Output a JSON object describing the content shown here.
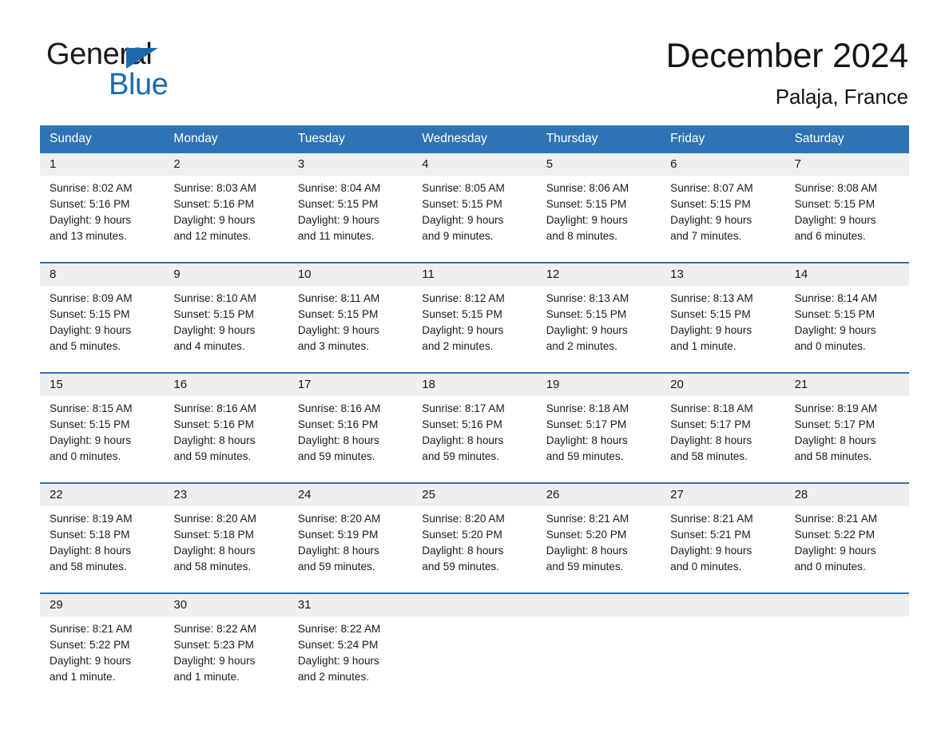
{
  "brand": {
    "name_part1": "General",
    "name_part2": "Blue",
    "triangle_icon": "triangle-icon",
    "accent_color": "#1b6ab0"
  },
  "header": {
    "title": "December 2024",
    "subtitle": "Palaja, France"
  },
  "colors": {
    "header_blue": "#2e74b5",
    "day_band_gray": "#efefef",
    "text": "#1a1a1a"
  },
  "weekdays": [
    "Sunday",
    "Monday",
    "Tuesday",
    "Wednesday",
    "Thursday",
    "Friday",
    "Saturday"
  ],
  "weeks": [
    [
      {
        "day": "1",
        "sunrise": "Sunrise: 8:02 AM",
        "sunset": "Sunset: 5:16 PM",
        "daylight1": "Daylight: 9 hours",
        "daylight2": "and 13 minutes."
      },
      {
        "day": "2",
        "sunrise": "Sunrise: 8:03 AM",
        "sunset": "Sunset: 5:16 PM",
        "daylight1": "Daylight: 9 hours",
        "daylight2": "and 12 minutes."
      },
      {
        "day": "3",
        "sunrise": "Sunrise: 8:04 AM",
        "sunset": "Sunset: 5:15 PM",
        "daylight1": "Daylight: 9 hours",
        "daylight2": "and 11 minutes."
      },
      {
        "day": "4",
        "sunrise": "Sunrise: 8:05 AM",
        "sunset": "Sunset: 5:15 PM",
        "daylight1": "Daylight: 9 hours",
        "daylight2": "and 9 minutes."
      },
      {
        "day": "5",
        "sunrise": "Sunrise: 8:06 AM",
        "sunset": "Sunset: 5:15 PM",
        "daylight1": "Daylight: 9 hours",
        "daylight2": "and 8 minutes."
      },
      {
        "day": "6",
        "sunrise": "Sunrise: 8:07 AM",
        "sunset": "Sunset: 5:15 PM",
        "daylight1": "Daylight: 9 hours",
        "daylight2": "and 7 minutes."
      },
      {
        "day": "7",
        "sunrise": "Sunrise: 8:08 AM",
        "sunset": "Sunset: 5:15 PM",
        "daylight1": "Daylight: 9 hours",
        "daylight2": "and 6 minutes."
      }
    ],
    [
      {
        "day": "8",
        "sunrise": "Sunrise: 8:09 AM",
        "sunset": "Sunset: 5:15 PM",
        "daylight1": "Daylight: 9 hours",
        "daylight2": "and 5 minutes."
      },
      {
        "day": "9",
        "sunrise": "Sunrise: 8:10 AM",
        "sunset": "Sunset: 5:15 PM",
        "daylight1": "Daylight: 9 hours",
        "daylight2": "and 4 minutes."
      },
      {
        "day": "10",
        "sunrise": "Sunrise: 8:11 AM",
        "sunset": "Sunset: 5:15 PM",
        "daylight1": "Daylight: 9 hours",
        "daylight2": "and 3 minutes."
      },
      {
        "day": "11",
        "sunrise": "Sunrise: 8:12 AM",
        "sunset": "Sunset: 5:15 PM",
        "daylight1": "Daylight: 9 hours",
        "daylight2": "and 2 minutes."
      },
      {
        "day": "12",
        "sunrise": "Sunrise: 8:13 AM",
        "sunset": "Sunset: 5:15 PM",
        "daylight1": "Daylight: 9 hours",
        "daylight2": "and 2 minutes."
      },
      {
        "day": "13",
        "sunrise": "Sunrise: 8:13 AM",
        "sunset": "Sunset: 5:15 PM",
        "daylight1": "Daylight: 9 hours",
        "daylight2": "and 1 minute."
      },
      {
        "day": "14",
        "sunrise": "Sunrise: 8:14 AM",
        "sunset": "Sunset: 5:15 PM",
        "daylight1": "Daylight: 9 hours",
        "daylight2": "and 0 minutes."
      }
    ],
    [
      {
        "day": "15",
        "sunrise": "Sunrise: 8:15 AM",
        "sunset": "Sunset: 5:15 PM",
        "daylight1": "Daylight: 9 hours",
        "daylight2": "and 0 minutes."
      },
      {
        "day": "16",
        "sunrise": "Sunrise: 8:16 AM",
        "sunset": "Sunset: 5:16 PM",
        "daylight1": "Daylight: 8 hours",
        "daylight2": "and 59 minutes."
      },
      {
        "day": "17",
        "sunrise": "Sunrise: 8:16 AM",
        "sunset": "Sunset: 5:16 PM",
        "daylight1": "Daylight: 8 hours",
        "daylight2": "and 59 minutes."
      },
      {
        "day": "18",
        "sunrise": "Sunrise: 8:17 AM",
        "sunset": "Sunset: 5:16 PM",
        "daylight1": "Daylight: 8 hours",
        "daylight2": "and 59 minutes."
      },
      {
        "day": "19",
        "sunrise": "Sunrise: 8:18 AM",
        "sunset": "Sunset: 5:17 PM",
        "daylight1": "Daylight: 8 hours",
        "daylight2": "and 59 minutes."
      },
      {
        "day": "20",
        "sunrise": "Sunrise: 8:18 AM",
        "sunset": "Sunset: 5:17 PM",
        "daylight1": "Daylight: 8 hours",
        "daylight2": "and 58 minutes."
      },
      {
        "day": "21",
        "sunrise": "Sunrise: 8:19 AM",
        "sunset": "Sunset: 5:17 PM",
        "daylight1": "Daylight: 8 hours",
        "daylight2": "and 58 minutes."
      }
    ],
    [
      {
        "day": "22",
        "sunrise": "Sunrise: 8:19 AM",
        "sunset": "Sunset: 5:18 PM",
        "daylight1": "Daylight: 8 hours",
        "daylight2": "and 58 minutes."
      },
      {
        "day": "23",
        "sunrise": "Sunrise: 8:20 AM",
        "sunset": "Sunset: 5:18 PM",
        "daylight1": "Daylight: 8 hours",
        "daylight2": "and 58 minutes."
      },
      {
        "day": "24",
        "sunrise": "Sunrise: 8:20 AM",
        "sunset": "Sunset: 5:19 PM",
        "daylight1": "Daylight: 8 hours",
        "daylight2": "and 59 minutes."
      },
      {
        "day": "25",
        "sunrise": "Sunrise: 8:20 AM",
        "sunset": "Sunset: 5:20 PM",
        "daylight1": "Daylight: 8 hours",
        "daylight2": "and 59 minutes."
      },
      {
        "day": "26",
        "sunrise": "Sunrise: 8:21 AM",
        "sunset": "Sunset: 5:20 PM",
        "daylight1": "Daylight: 8 hours",
        "daylight2": "and 59 minutes."
      },
      {
        "day": "27",
        "sunrise": "Sunrise: 8:21 AM",
        "sunset": "Sunset: 5:21 PM",
        "daylight1": "Daylight: 9 hours",
        "daylight2": "and 0 minutes."
      },
      {
        "day": "28",
        "sunrise": "Sunrise: 8:21 AM",
        "sunset": "Sunset: 5:22 PM",
        "daylight1": "Daylight: 9 hours",
        "daylight2": "and 0 minutes."
      }
    ],
    [
      {
        "day": "29",
        "sunrise": "Sunrise: 8:21 AM",
        "sunset": "Sunset: 5:22 PM",
        "daylight1": "Daylight: 9 hours",
        "daylight2": "and 1 minute."
      },
      {
        "day": "30",
        "sunrise": "Sunrise: 8:22 AM",
        "sunset": "Sunset: 5:23 PM",
        "daylight1": "Daylight: 9 hours",
        "daylight2": "and 1 minute."
      },
      {
        "day": "31",
        "sunrise": "Sunrise: 8:22 AM",
        "sunset": "Sunset: 5:24 PM",
        "daylight1": "Daylight: 9 hours",
        "daylight2": "and 2 minutes."
      },
      {
        "day": "",
        "sunrise": "",
        "sunset": "",
        "daylight1": "",
        "daylight2": ""
      },
      {
        "day": "",
        "sunrise": "",
        "sunset": "",
        "daylight1": "",
        "daylight2": ""
      },
      {
        "day": "",
        "sunrise": "",
        "sunset": "",
        "daylight1": "",
        "daylight2": ""
      },
      {
        "day": "",
        "sunrise": "",
        "sunset": "",
        "daylight1": "",
        "daylight2": ""
      }
    ]
  ]
}
